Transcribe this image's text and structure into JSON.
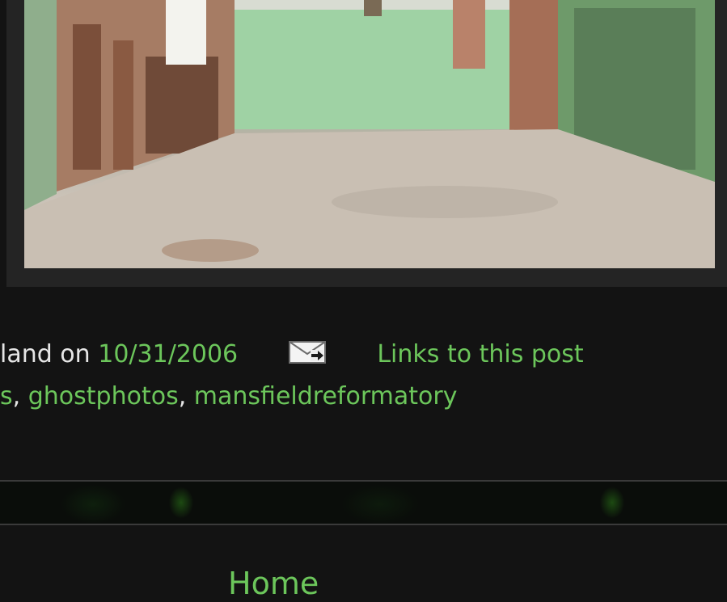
{
  "post": {
    "photo_alt": "Abandoned room with peeling green paint",
    "posted_by_fragment": "land on",
    "date": "10/31/2006",
    "email_icon": "email-post-icon",
    "backlinks_label": "Links to this post",
    "labels_prefix": "s",
    "labels": [
      "ghostphotos",
      "mansfieldreformatory"
    ],
    "separator": ","
  },
  "nav": {
    "home_label": "Home"
  },
  "colors": {
    "background": "#131313",
    "link": "#6cc65b",
    "text": "#e6e6e6",
    "frame": "#242424"
  }
}
